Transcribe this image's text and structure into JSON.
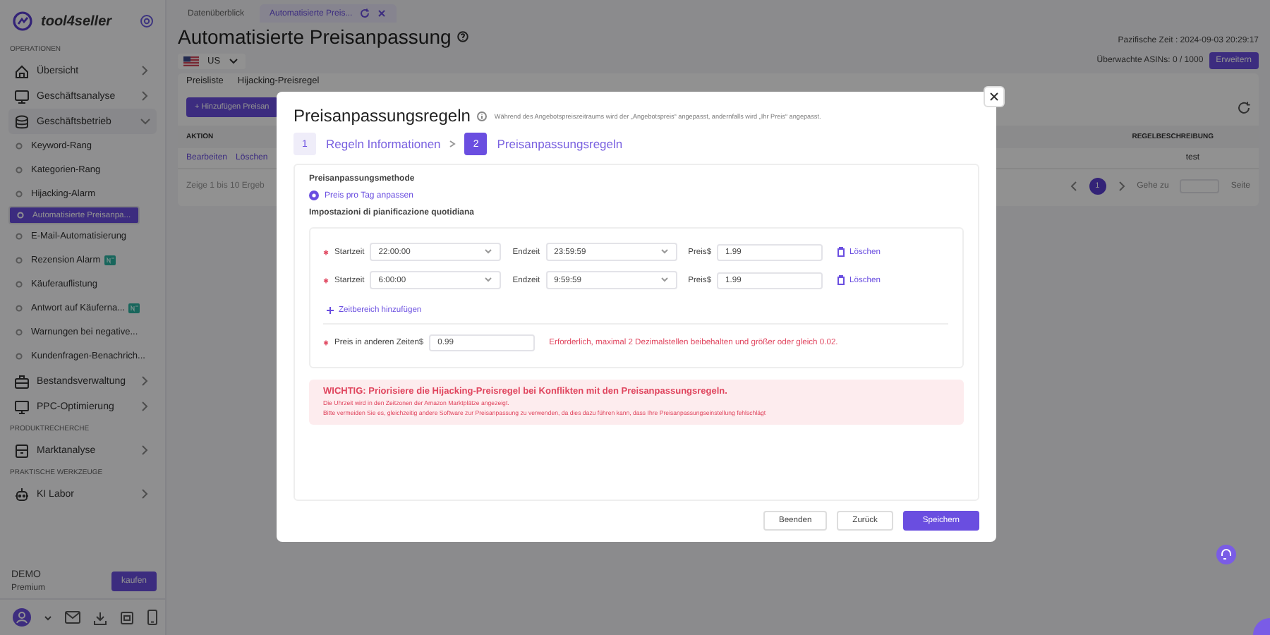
{
  "sidebar": {
    "brand": "tool4seller",
    "groups": [
      {
        "title": "OPERATIONEN",
        "items": [
          {
            "label": "Übersicht",
            "expanded": false
          },
          {
            "label": "Geschäftsanalyse",
            "expanded": false
          },
          {
            "label": "Geschäftsbetrieb",
            "expanded": true,
            "children": [
              {
                "label": "Keyword-Rang",
                "selected": false,
                "tagged": false
              },
              {
                "label": "Kategorien-Rang",
                "selected": false,
                "tagged": false
              },
              {
                "label": "Hijacking-Alarm",
                "selected": false,
                "tagged": false
              },
              {
                "label": "Automatisierte Preisanpa...",
                "selected": true,
                "tagged": false
              },
              {
                "label": "E-Mail-Automatisierung",
                "selected": false,
                "tagged": false
              },
              {
                "label": "Rezension Alarm",
                "selected": false,
                "tagged": true
              },
              {
                "label": "Käuferauflistung",
                "selected": false,
                "tagged": false
              },
              {
                "label": "Antwort auf Käuferna...",
                "selected": false,
                "tagged": true
              },
              {
                "label": "Warnungen bei negative...",
                "selected": false,
                "tagged": false
              },
              {
                "label": "Kundenfragen-Benachrich...",
                "selected": false,
                "tagged": false
              }
            ]
          },
          {
            "label": "Bestandsverwaltung",
            "expanded": false
          },
          {
            "label": "PPC-Optimierung",
            "expanded": false
          }
        ]
      },
      {
        "title": "PRODUKTRECHERCHE",
        "items": [
          {
            "label": "Marktanalyse",
            "expanded": false
          }
        ]
      },
      {
        "title": "PRAKTISCHE WERKZEUGE",
        "items": [
          {
            "label": "KI Labor",
            "expanded": false
          }
        ]
      }
    ],
    "plan": {
      "name": "DEMO",
      "tier": "Premium",
      "button": "kaufen"
    }
  },
  "top_tabs": [
    {
      "label": "Datenüberblick",
      "selected": false
    },
    {
      "label": "Automatisierte Preis...",
      "selected": true
    }
  ],
  "page": {
    "title": "Automatisierte Preisanpassung",
    "country": "US",
    "time": "Pazifische Zeit : 2024-09-03 20:29:17",
    "asins": "Überwachte ASINs: 0 / 1000",
    "upgrade": "Erweitern",
    "tabs": [
      {
        "label": "Preisliste",
        "selected": false
      },
      {
        "label": "Hijacking-Preisregel",
        "selected": false
      }
    ],
    "add_button": "+ Hinzufügen Preisan",
    "table": {
      "columns": [
        "AKTION",
        "REGELBESCHREIBUNG"
      ],
      "rows": [
        {
          "actions": [
            "Bearbeiten",
            "Löschen"
          ],
          "description": "test"
        }
      ]
    },
    "summary": "Zeige 1 bis 10 Ergeb",
    "pagination": {
      "pages": [
        {
          "label": "1",
          "selected": true
        }
      ],
      "goto": "Gehe zu",
      "suffix": "Seite"
    }
  },
  "modal": {
    "title": "Preisanpassungsregeln",
    "hint": "Während des Angebotspreiszeitraums wird der „Angebotspreis“ angepasst, andernfalls wird „Ihr Preis“ angepasst.",
    "steps": [
      {
        "number": "1",
        "label": "Regeln Informationen",
        "selected": false
      },
      {
        "number": "2",
        "label": "Preisanpassungsregeln",
        "selected": true
      }
    ],
    "method_label": "Preisanpassungsmethode",
    "method": {
      "label": "Preis pro Tag anpassen",
      "selected": true
    },
    "schedule_label": "Impostazioni di pianificazione quotidiana",
    "slots": [
      {
        "required": true,
        "start_label": "Startzeit",
        "start": "22:00:00",
        "end_label": "Endzeit",
        "end": "23:59:59",
        "price_label": "Preis$",
        "price": "1.99",
        "delete": "Löschen"
      },
      {
        "required": true,
        "start_label": "Startzeit",
        "start": "6:00:00",
        "end_label": "Endzeit",
        "end": "9:59:59",
        "price_label": "Preis$",
        "price": "1.99",
        "delete": "Löschen"
      }
    ],
    "add_slot": "Zeitbereich hinzufügen",
    "other_price": {
      "required": true,
      "label": "Preis in anderen Zeiten$",
      "value": "0.99",
      "error": "Erforderlich, maximal 2 Dezimalstellen beibehalten und größer oder gleich 0.02."
    },
    "warning": {
      "title": "WICHTIG: Priorisiere die Hijacking-Preisregel bei Konflikten mit den Preisanpassungsregeln.",
      "lines": [
        "Die Uhrzeit wird in den Zeitzonen der Amazon Marktplätze angezeigt.",
        "Bitte vermeiden Sie es, gleichzeitig andere Software zur Preisanpassung zu verwenden, da dies dazu führen kann, dass Ihre Preisanpassungseinstellung fehlschlägt"
      ]
    },
    "buttons": [
      {
        "label": "Beenden",
        "kind": "default"
      },
      {
        "label": "Zurück",
        "kind": "default"
      },
      {
        "label": "Speichern",
        "kind": "primary"
      }
    ]
  }
}
